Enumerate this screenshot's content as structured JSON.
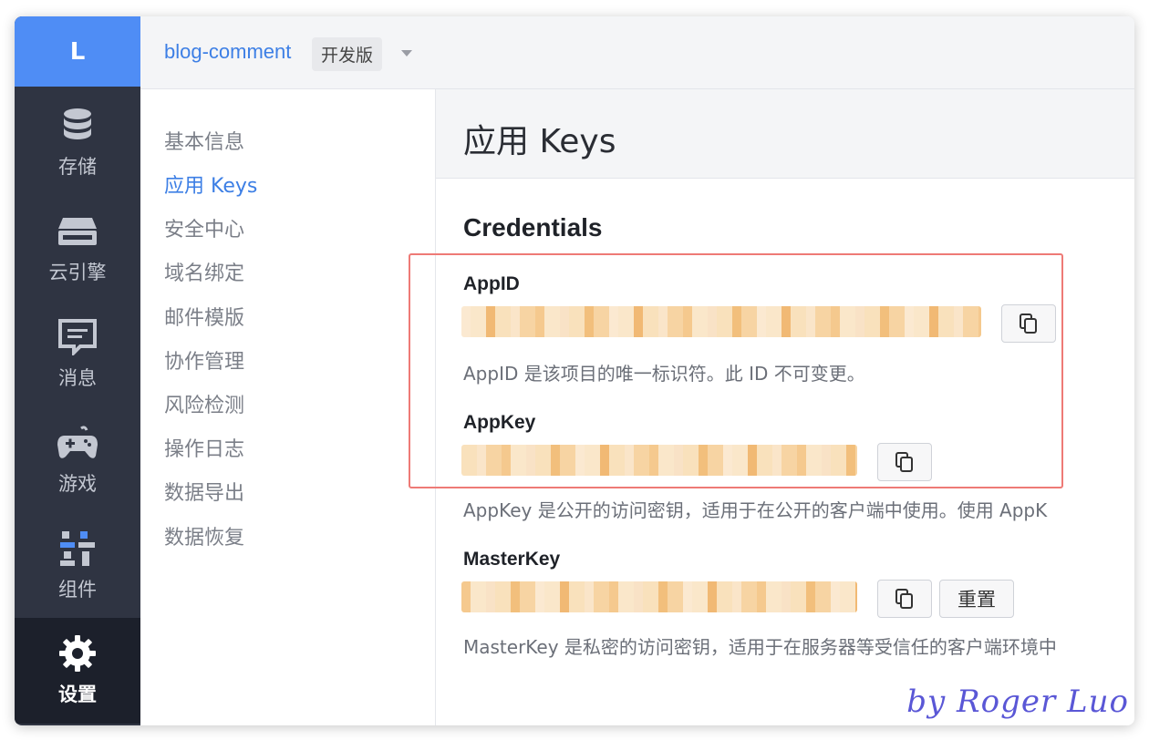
{
  "rail": {
    "logo": "L",
    "items": [
      {
        "label": "存储",
        "icon": "database-icon"
      },
      {
        "label": "云引擎",
        "icon": "server-icon"
      },
      {
        "label": "消息",
        "icon": "message-icon"
      },
      {
        "label": "游戏",
        "icon": "gamepad-icon"
      },
      {
        "label": "组件",
        "icon": "components-icon"
      },
      {
        "label": "设置",
        "icon": "gear-icon"
      }
    ]
  },
  "header": {
    "app_name": "blog-comment",
    "plan_badge": "开发版"
  },
  "subnav": {
    "items": [
      {
        "label": "基本信息"
      },
      {
        "label": "应用 Keys"
      },
      {
        "label": "安全中心"
      },
      {
        "label": "域名绑定"
      },
      {
        "label": "邮件模版"
      },
      {
        "label": "协作管理"
      },
      {
        "label": "风险检测"
      },
      {
        "label": "操作日志"
      },
      {
        "label": "数据导出"
      },
      {
        "label": "数据恢复"
      }
    ]
  },
  "main": {
    "page_title": "应用 Keys",
    "section_title": "Credentials",
    "appid": {
      "label": "AppID",
      "help": "AppID 是该项目的唯一标识符。此 ID 不可变更。"
    },
    "appkey": {
      "label": "AppKey",
      "help": "AppKey 是公开的访问密钥，适用于在公开的客户端中使用。使用 AppK"
    },
    "masterkey": {
      "label": "MasterKey",
      "help": "MasterKey 是私密的访问密钥，适用于在服务器等受信任的客户端环境中",
      "reset_label": "重置"
    }
  },
  "watermark": "by Roger Luo",
  "colors": {
    "rail_bg": "#2f3442",
    "rail_active_bg": "#1c202b",
    "accent": "#4f8df5",
    "link": "#3d7fe5",
    "highlight_border": "#ee7a76"
  }
}
